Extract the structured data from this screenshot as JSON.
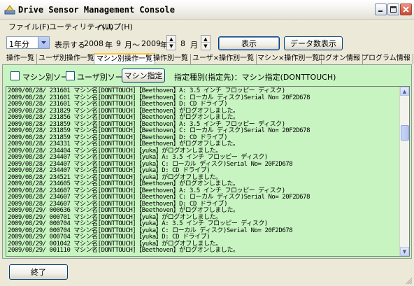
{
  "window": {
    "title": "Drive Sensor Management Console"
  },
  "menu": {
    "items": [
      "ファイル(F)",
      "ユーティリティ(U)",
      "ヘルプ(H)"
    ]
  },
  "toolbar": {
    "period_value": "1年分",
    "display_label": "表示する",
    "from_year": "2008",
    "year_unit_1": "年",
    "from_month": "9",
    "month_tilde": "月～",
    "to_year": "2009",
    "year_unit_2": "年",
    "to_month": "8",
    "month_unit": "月",
    "show_button": "表示",
    "count_button": "データ数表示"
  },
  "tabs": [
    "操作一覧",
    "ユーザ別操作一覧",
    "マシン別操作一覧",
    "操作別一覧",
    "ユーザ×操作別一覧",
    "マシン×操作別一覧",
    "ログオン情報",
    "プログラム情報"
  ],
  "active_tab_index": 2,
  "filters": {
    "machine_sort_label": "マシン別ソート",
    "user_sort_label": "ユーザ別ソート",
    "machine_button": "マシン指定",
    "info_text": "指定種別(指定先)：マシン指定(DONTTOUCH)"
  },
  "log": [
    "2009/08/28/ 231601 マシン名[DONTTOUCH]【Beethoven】A: 3.5 インチ フロッピー ディスク)",
    "2009/08/28/ 231601 マシン名[DONTTOUCH]【Beethoven】C: ローカル ディスク)Serial No= 20F2D678",
    "2009/08/28/ 231601 マシン名[DONTTOUCH]【Beethoven】D: CD ドライブ)",
    "2009/08/28/ 231829 マシン名[DONTTOUCH]【Beethoven】がログオフしました。",
    "2009/08/28/ 231856 マシン名[DONTTOUCH]【Beethoven】がログオンしました。",
    "2009/08/28/ 231859 マシン名[DONTTOUCH]【Beethoven】A: 3.5 インチ フロッピー ディスク)",
    "2009/08/28/ 231859 マシン名[DONTTOUCH]【Beethoven】C: ローカル ディスク)Serial No= 20F2D678",
    "2009/08/28/ 231859 マシン名[DONTTOUCH]【Beethoven】D: CD ドライブ)",
    "2009/08/28/ 234331 マシン名[DONTTOUCH]【Beethoven】がログオフしました。",
    "2009/08/28/ 234404 マシン名[DONTTOUCH]【yuka】がログオンしました。",
    "2009/08/28/ 234407 マシン名[DONTTOUCH]【yuka】A: 3.5 インチ フロッピー ディスク)",
    "2009/08/28/ 234407 マシン名[DONTTOUCH]【yuka】C: ローカル ディスク)Serial No= 20F2D678",
    "2009/08/28/ 234407 マシン名[DONTTOUCH]【yuka】D: CD ドライブ)",
    "2009/08/28/ 234521 マシン名[DONTTOUCH]【yuka】がログオフしました。",
    "2009/08/28/ 234605 マシン名[DONTTOUCH]【Beethoven】がログオンしました。",
    "2009/08/28/ 234607 マシン名[DONTTOUCH]【Beethoven】A: 3.5 インチ フロッピー ディスク)",
    "2009/08/28/ 234607 マシン名[DONTTOUCH]【Beethoven】C: ローカル ディスク)Serial No= 20F2D678",
    "2009/08/28/ 234607 マシン名[DONTTOUCH]【Beethoven】D: CD ドライブ)",
    "2009/08/29/ 000636 マシン名[DONTTOUCH]【Beethoven】がログオフしました。",
    "2009/08/29/ 000701 マシン名[DONTTOUCH]【yuka】がログオンしました。",
    "2009/08/29/ 000704 マシン名[DONTTOUCH]【yuka】A: 3.5 インチ フロッピー ディスク)",
    "2009/08/29/ 000704 マシン名[DONTTOUCH]【yuka】C: ローカル ディスク)Serial No= 20F2D678",
    "2009/08/29/ 000704 マシン名[DONTTOUCH]【yuka】D: CD ドライブ)",
    "2009/08/29/ 001042 マシン名[DONTTOUCH]【yuka】がログオフしました。",
    "2009/08/29/ 001110 マシン名[DONTTOUCH]【Beethoven】がログオンしました。"
  ],
  "footer": {
    "exit_button": "終了"
  },
  "icons": {
    "app": "app-icon",
    "minimize": "minimize-icon",
    "maximize": "maximize-icon",
    "close": "close-icon"
  },
  "colors": {
    "panel_bg": "#c7f4c0",
    "window_bg": "#ece9d8",
    "close_red": "#c9452f"
  }
}
